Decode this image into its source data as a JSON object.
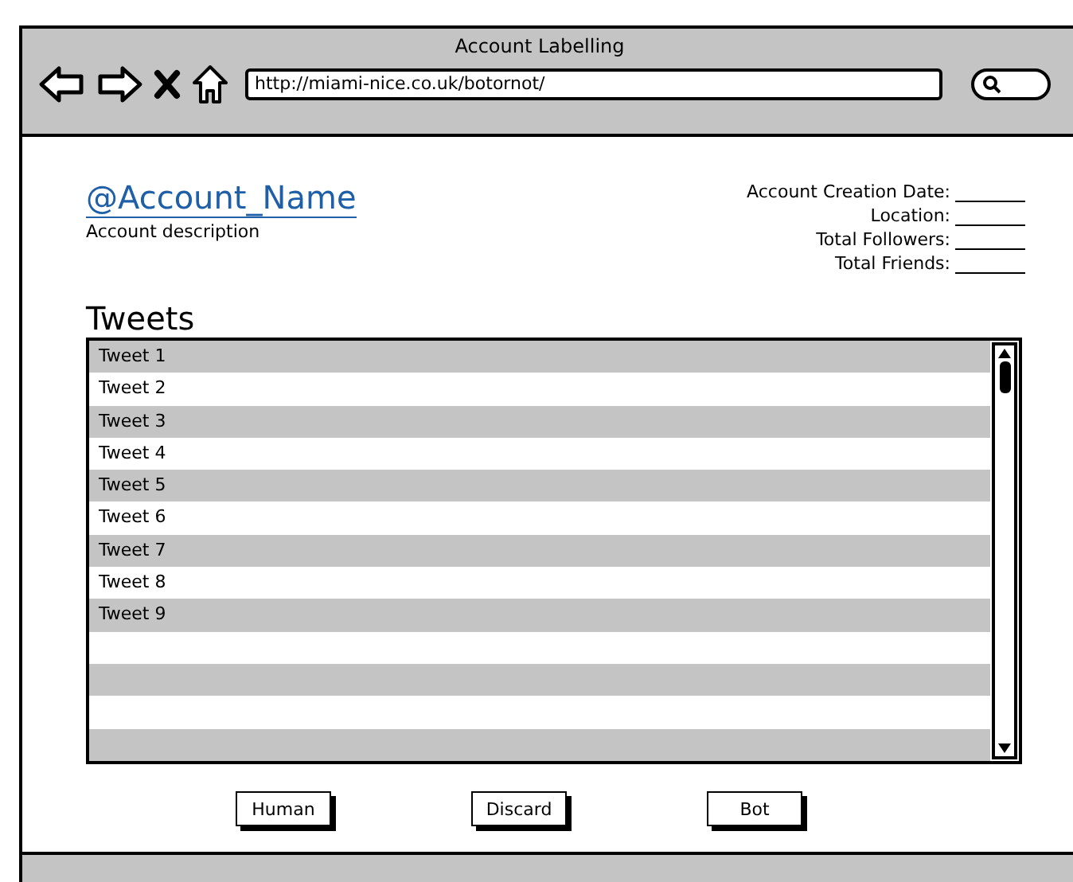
{
  "window": {
    "title": "Account Labelling"
  },
  "browser": {
    "url": "http://miami-nice.co.uk/botornot/"
  },
  "account": {
    "name": "@Account_Name",
    "description": "Account description"
  },
  "details": [
    {
      "label": "Account Creation Date:"
    },
    {
      "label": "Location:"
    },
    {
      "label": "Total Followers:"
    },
    {
      "label": "Total Friends:"
    }
  ],
  "tweets": {
    "heading": "Tweets",
    "rows": [
      "Tweet 1",
      "Tweet 2",
      "Tweet 3",
      "Tweet 4",
      "Tweet 5",
      "Tweet 6",
      "Tweet 7",
      "Tweet 8",
      "Tweet 9"
    ]
  },
  "buttons": [
    "Human",
    "Discard",
    "Bot"
  ]
}
